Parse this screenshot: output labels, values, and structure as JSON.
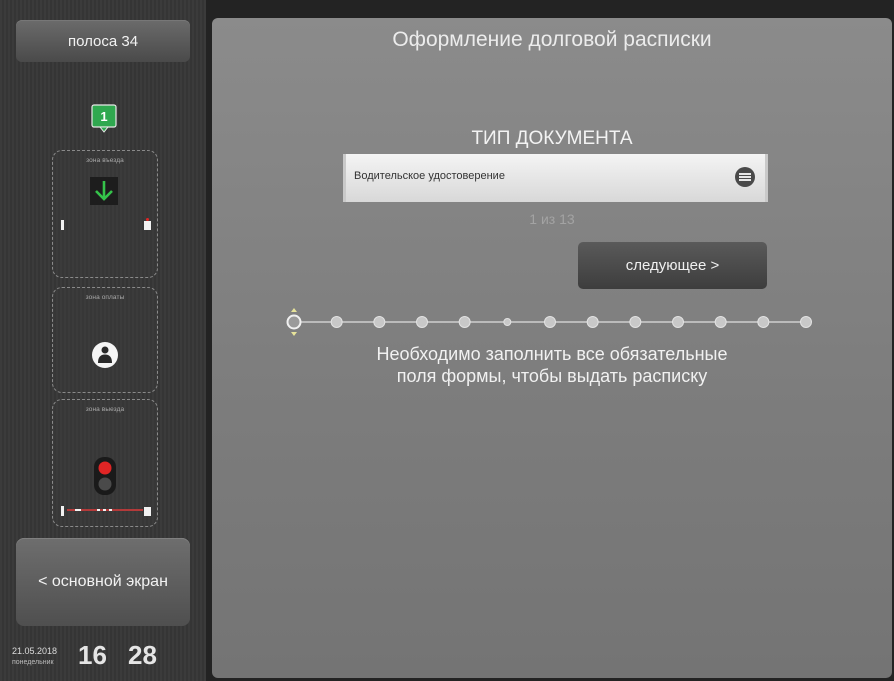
{
  "sidebar": {
    "lane_label": "полоса 34",
    "lane_badge_number": "1",
    "zones": [
      {
        "label": "зона въезда"
      },
      {
        "label": "зона оплаты"
      },
      {
        "label": "зона выезда"
      }
    ],
    "home_button_label": "< основной экран",
    "clock": {
      "date": "21.05.2018",
      "weekday": "понедельник",
      "hours": "16",
      "minutes": "28"
    }
  },
  "main": {
    "title": "Оформление долговой расписки",
    "document_type_label": "ТИП ДОКУМЕНТА",
    "document_type_value": "Водительское удостоверение",
    "counter": "1 из 13",
    "next_button_label": "следующее >",
    "steps_total": 13,
    "current_step": 1,
    "hint_line1": "Необходимо заполнить все обязательные",
    "hint_line2": "поля формы, чтобы выдать расписку"
  },
  "colors": {
    "badge_green": "#2fa84f",
    "arrow_green": "#35c34a",
    "signal_red": "#e02525",
    "panel_gray": "#838383",
    "button_dark": "#474747"
  },
  "icons": {
    "lane_badge": "green-number-badge",
    "entry_arrow": "green-down-arrow-icon",
    "payment": "person-in-circle-icon",
    "traffic_light": "traffic-light-icon",
    "select_menu": "menu-lines-icon"
  }
}
